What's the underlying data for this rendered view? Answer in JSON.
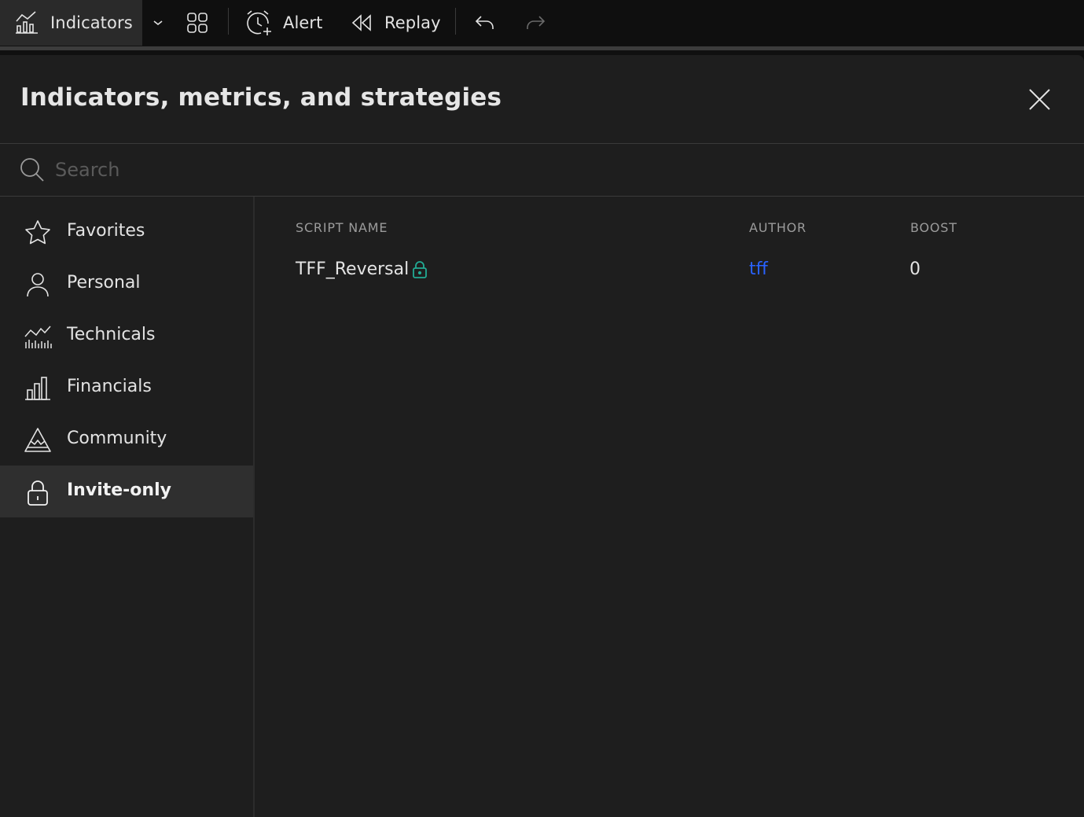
{
  "toolbar": {
    "indicators_label": "Indicators",
    "alert_label": "Alert",
    "replay_label": "Replay"
  },
  "dialog": {
    "title": "Indicators, metrics, and strategies",
    "search": {
      "placeholder": "Search",
      "value": ""
    }
  },
  "sidebar": {
    "items": [
      {
        "label": "Favorites",
        "icon": "star-icon"
      },
      {
        "label": "Personal",
        "icon": "user-icon"
      },
      {
        "label": "Technicals",
        "icon": "technicals-chart-icon"
      },
      {
        "label": "Financials",
        "icon": "bar-chart-icon"
      },
      {
        "label": "Community",
        "icon": "mountain-icon"
      },
      {
        "label": "Invite-only",
        "icon": "lock-icon",
        "active": true
      }
    ]
  },
  "table": {
    "columns": [
      "SCRIPT NAME",
      "AUTHOR",
      "BOOST"
    ],
    "rows": [
      {
        "script_name": "TFF_Reversal",
        "author": "tff",
        "boost": "0",
        "locked": true
      }
    ]
  },
  "colors": {
    "background": "#1e1e1e",
    "toolbar": "#0f0f0f",
    "active_item": "#2f2f2f",
    "author_link": "#2962ff",
    "lock_badge": "#22ab94"
  }
}
